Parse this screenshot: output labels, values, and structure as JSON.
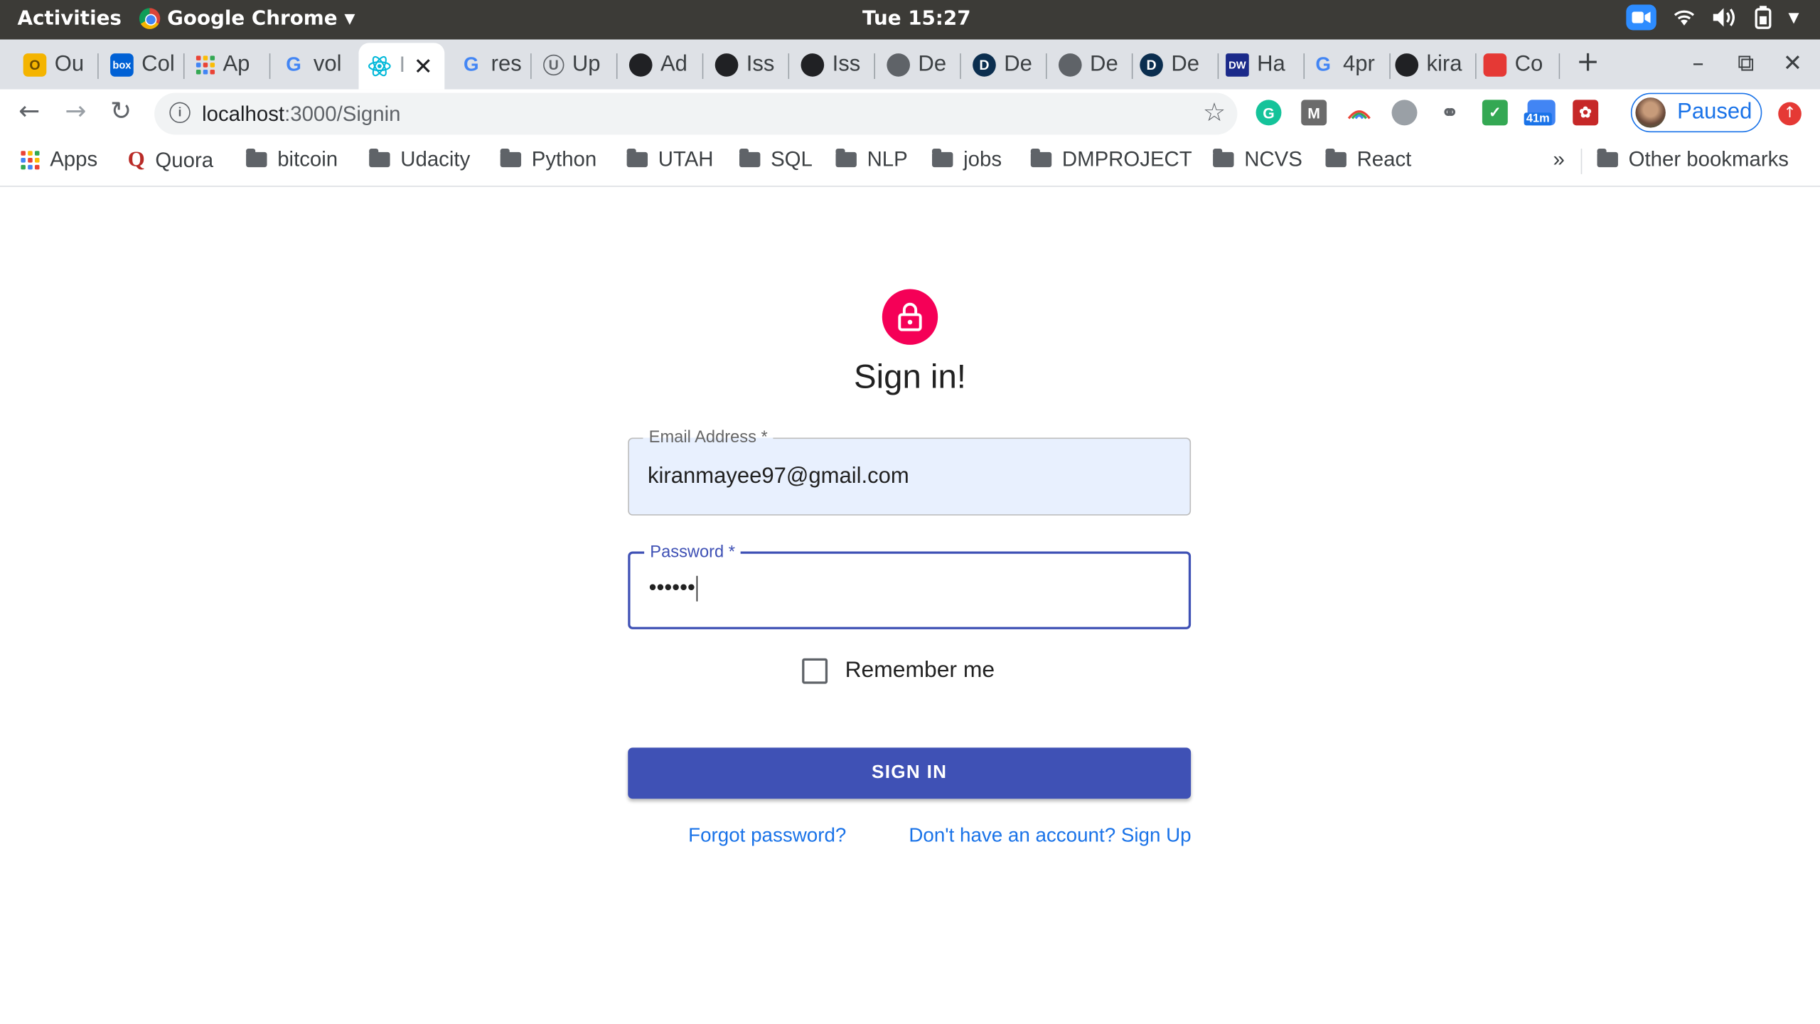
{
  "os_topbar": {
    "activities": "Activities",
    "app_name": "Google Chrome",
    "clock": "Tue 15:27"
  },
  "tabs": [
    {
      "label": "Ou",
      "icon": "outlook-icon",
      "color": "#f4b400"
    },
    {
      "label": "Col",
      "icon": "box-icon",
      "color": "#0061d5"
    },
    {
      "label": "Ap",
      "icon": "apps-grid-icon",
      "color": "#ea4335"
    },
    {
      "label": "vol",
      "icon": "google-icon",
      "color": "#4285f4"
    },
    {
      "label": "I",
      "icon": "react-icon",
      "color": "#00b8d9",
      "active": true
    },
    {
      "label": "res",
      "icon": "google-icon",
      "color": "#4285f4"
    },
    {
      "label": "Up",
      "icon": "udacity-icon",
      "color": "#5f6368"
    },
    {
      "label": "Ad",
      "icon": "github-icon",
      "color": "#202124"
    },
    {
      "label": "Iss",
      "icon": "github-icon",
      "color": "#202124"
    },
    {
      "label": "Iss",
      "icon": "github-icon",
      "color": "#202124"
    },
    {
      "label": "De",
      "icon": "globe-icon",
      "color": "#5f6368"
    },
    {
      "label": "De",
      "icon": "d-icon",
      "color": "#0b2e4f"
    },
    {
      "label": "De",
      "icon": "globe-icon",
      "color": "#5f6368"
    },
    {
      "label": "De",
      "icon": "d-icon",
      "color": "#0b2e4f"
    },
    {
      "label": "Ha",
      "icon": "dw-icon",
      "color": "#1b2a8a"
    },
    {
      "label": "4pr",
      "icon": "google-icon",
      "color": "#4285f4"
    },
    {
      "label": "kira",
      "icon": "github-icon",
      "color": "#202124"
    },
    {
      "label": "Co",
      "icon": "flag-icon",
      "color": "#e53935"
    }
  ],
  "address_bar": {
    "host": "localhost",
    "path": ":3000/Signin"
  },
  "extensions": {
    "badge": "41m",
    "profile_status": "Paused"
  },
  "bookmarks": {
    "apps": "Apps",
    "quora": "Quora",
    "folders": [
      "bitcoin",
      "Udacity",
      "Python",
      "UTAH",
      "SQL",
      "NLP",
      "jobs",
      "DMPROJECT",
      "NCVS",
      "React"
    ],
    "overflow": "»",
    "other": "Other bookmarks"
  },
  "signin": {
    "title": "Sign in!",
    "email_label": "Email Address *",
    "email_value": "kiranmayee97@gmail.com",
    "password_label": "Password *",
    "password_value": "••••••",
    "remember_label": "Remember me",
    "remember_checked": false,
    "button_label": "SIGN IN",
    "forgot_link": "Forgot password?",
    "signup_link": "Don't have an account? Sign Up"
  },
  "colors": {
    "primary": "#3f51b5",
    "avatar": "#f50057",
    "link": "#1a73e8"
  }
}
